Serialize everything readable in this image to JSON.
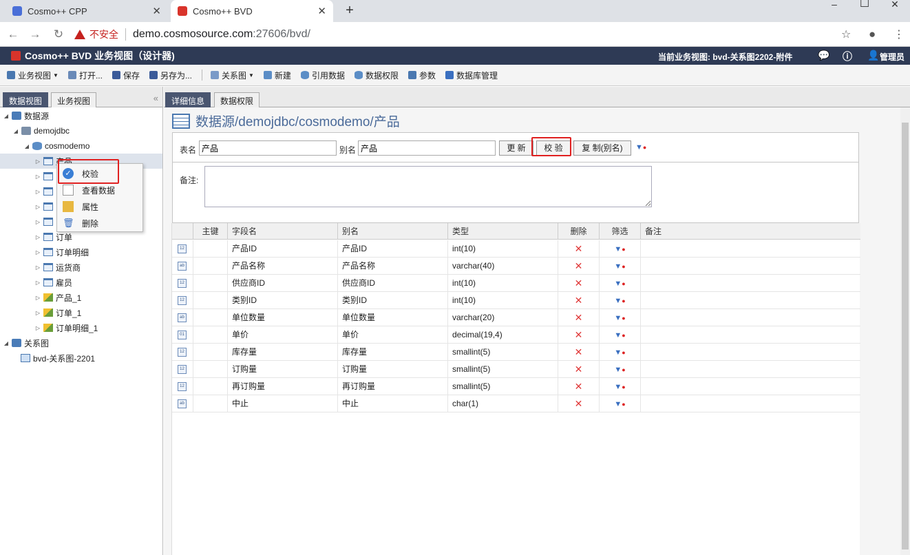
{
  "browser": {
    "tabs": [
      {
        "title": "Cosmo++ CPP",
        "active": false
      },
      {
        "title": "Cosmo++ BVD",
        "active": true
      }
    ],
    "address": {
      "security": "不安全",
      "host": "demo.cosmosource.com",
      "rest": ":27606/bvd/"
    }
  },
  "app": {
    "title": "Cosmo++ BVD 业务视图（设计器)",
    "current_view": "当前业务视图: bvd-关系图2202-附件",
    "user": "管理员"
  },
  "toolbar": {
    "business_view": "业务视图",
    "open": "打开...",
    "save": "保存",
    "save_as": "另存为...",
    "relation": "关系图",
    "new": "新建",
    "reference": "引用数据",
    "data_perm": "数据权限",
    "params": "参数",
    "db_manage": "数据库管理"
  },
  "left": {
    "tabs": [
      "数据视图",
      "业务视图"
    ],
    "tree": {
      "datasource": "数据源",
      "demojdbc": "demojdbc",
      "cosmodemo": "cosmodemo",
      "product": "产品",
      "order": "订单",
      "order_detail": "订单明细",
      "shipper": "运货商",
      "employee": "雇员",
      "product_1": "产品_1",
      "order_1": "订单_1",
      "order_detail_1": "订单明细_1",
      "relation": "关系图",
      "bvd_rel": "bvd-关系图-2201"
    },
    "menu": {
      "check": "校验",
      "view_data": "查看数据",
      "properties": "属性",
      "delete": "删除"
    }
  },
  "right": {
    "tabs": [
      "详细信息",
      "数据权限"
    ],
    "heading": "数据源/demojdbc/cosmodemo/产品",
    "form": {
      "table_label": "表名",
      "table_value": "产品",
      "alias_label": "别名",
      "alias_value": "产品",
      "update_btn": "更 新",
      "check_btn": "校 验",
      "copy_btn": "复 制(别名)",
      "remark_label": "备注:"
    },
    "grid": {
      "headers": [
        "主键",
        "字段名",
        "别名",
        "类型",
        "删除",
        "筛选",
        "备注"
      ],
      "rows": [
        {
          "icon": "12",
          "name": "产品ID",
          "alias": "产品ID",
          "type": "int(10)"
        },
        {
          "icon": "ab",
          "name": "产品名称",
          "alias": "产品名称",
          "type": "varchar(40)"
        },
        {
          "icon": "12",
          "name": "供应商ID",
          "alias": "供应商ID",
          "type": "int(10)"
        },
        {
          "icon": "12",
          "name": "类别ID",
          "alias": "类别ID",
          "type": "int(10)"
        },
        {
          "icon": "ab",
          "name": "单位数量",
          "alias": "单位数量",
          "type": "varchar(20)"
        },
        {
          "icon": "01",
          "name": "单价",
          "alias": "单价",
          "type": "decimal(19,4)"
        },
        {
          "icon": "12",
          "name": "库存量",
          "alias": "库存量",
          "type": "smallint(5)"
        },
        {
          "icon": "12",
          "name": "订购量",
          "alias": "订购量",
          "type": "smallint(5)"
        },
        {
          "icon": "12",
          "name": "再订购量",
          "alias": "再订购量",
          "type": "smallint(5)"
        },
        {
          "icon": "ab",
          "name": "中止",
          "alias": "中止",
          "type": "char(1)"
        }
      ]
    }
  },
  "colors": {
    "app_header": "#2e3a55",
    "active_tab": "#4a5670",
    "highlight": "#e02020",
    "delete": "#e03a3a"
  }
}
